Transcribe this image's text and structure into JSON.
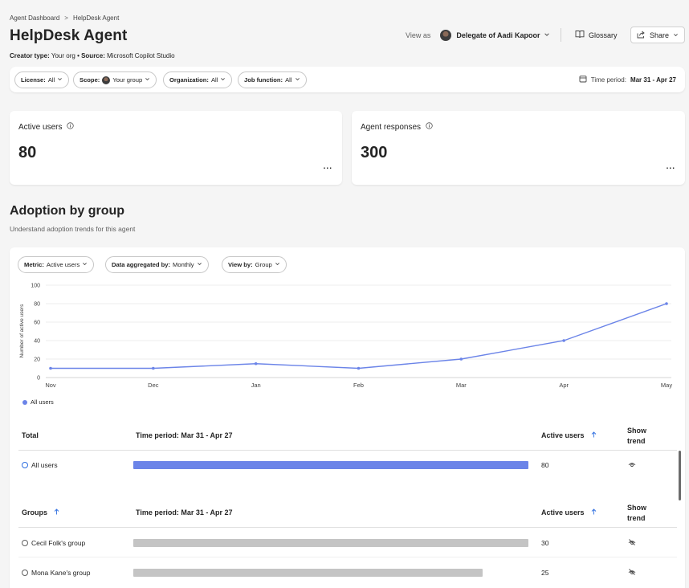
{
  "breadcrumb": {
    "root": "Agent Dashboard",
    "sep": ">",
    "current": "HelpDesk Agent"
  },
  "page": {
    "title": "HelpDesk Agent",
    "creator_type_label": "Creator type:",
    "creator_type_value": "Your org",
    "source_label": "• Source:",
    "source_value": "Microsoft Copilot Studio"
  },
  "header": {
    "view_as_label": "View as",
    "delegate": "Delegate of Aadi Kapoor",
    "glossary": "Glossary",
    "share": "Share"
  },
  "filters": {
    "license_label": "License:",
    "license_value": "All",
    "scope_label": "Scope:",
    "scope_value": "Your group",
    "org_label": "Organization:",
    "org_value": "All",
    "job_label": "Job function:",
    "job_value": "All",
    "time_label": "Time period:",
    "time_value": "Mar 31 - Apr 27"
  },
  "kpis": {
    "active_users_label": "Active users",
    "active_users_value": "80",
    "agent_responses_label": "Agent responses",
    "agent_responses_value": "300",
    "more": "..."
  },
  "section": {
    "title": "Adoption by group",
    "subtitle": "Understand adoption trends for this agent"
  },
  "chart_filters": {
    "metric_label": "Metric:",
    "metric_value": "Active users",
    "agg_label": "Data aggregated by:",
    "agg_value": "Monthly",
    "viewby_label": "View by:",
    "viewby_value": "Group"
  },
  "chart_data": {
    "type": "line",
    "x": [
      "Nov",
      "Dec",
      "Jan",
      "Feb",
      "Mar",
      "Apr",
      "May"
    ],
    "series": [
      {
        "name": "All users",
        "values": [
          10,
          10,
          15,
          10,
          20,
          40,
          80
        ]
      }
    ],
    "ylabel": "Number of active users",
    "ylim": [
      0,
      100
    ],
    "yticks": [
      0,
      20,
      40,
      60,
      80,
      100
    ],
    "grid": true,
    "legend": "bottom-left",
    "color": "#6b84e8"
  },
  "total_table": {
    "col_total": "Total",
    "col_period": "Time period: Mar 31 - Apr 27",
    "col_active": "Active users",
    "col_trend_1": "Show",
    "col_trend_2": "trend",
    "rows": [
      {
        "name": "All users",
        "value": "80",
        "fraction": 1.0
      }
    ]
  },
  "groups_table": {
    "col_groups": "Groups",
    "col_period": "Time period: Mar 31 - Apr 27",
    "col_active": "Active users",
    "col_trend_1": "Show",
    "col_trend_2": "trend",
    "rows": [
      {
        "name": "Cecil Folk's group",
        "value": "30",
        "fraction": 1.0
      },
      {
        "name": "Mona Kane's group",
        "value": "25",
        "fraction": 0.888
      }
    ]
  },
  "colors": {
    "accent": "#6b84e8",
    "bar_gray": "#c4c4c4",
    "link_blue": "#2f6fe0"
  }
}
